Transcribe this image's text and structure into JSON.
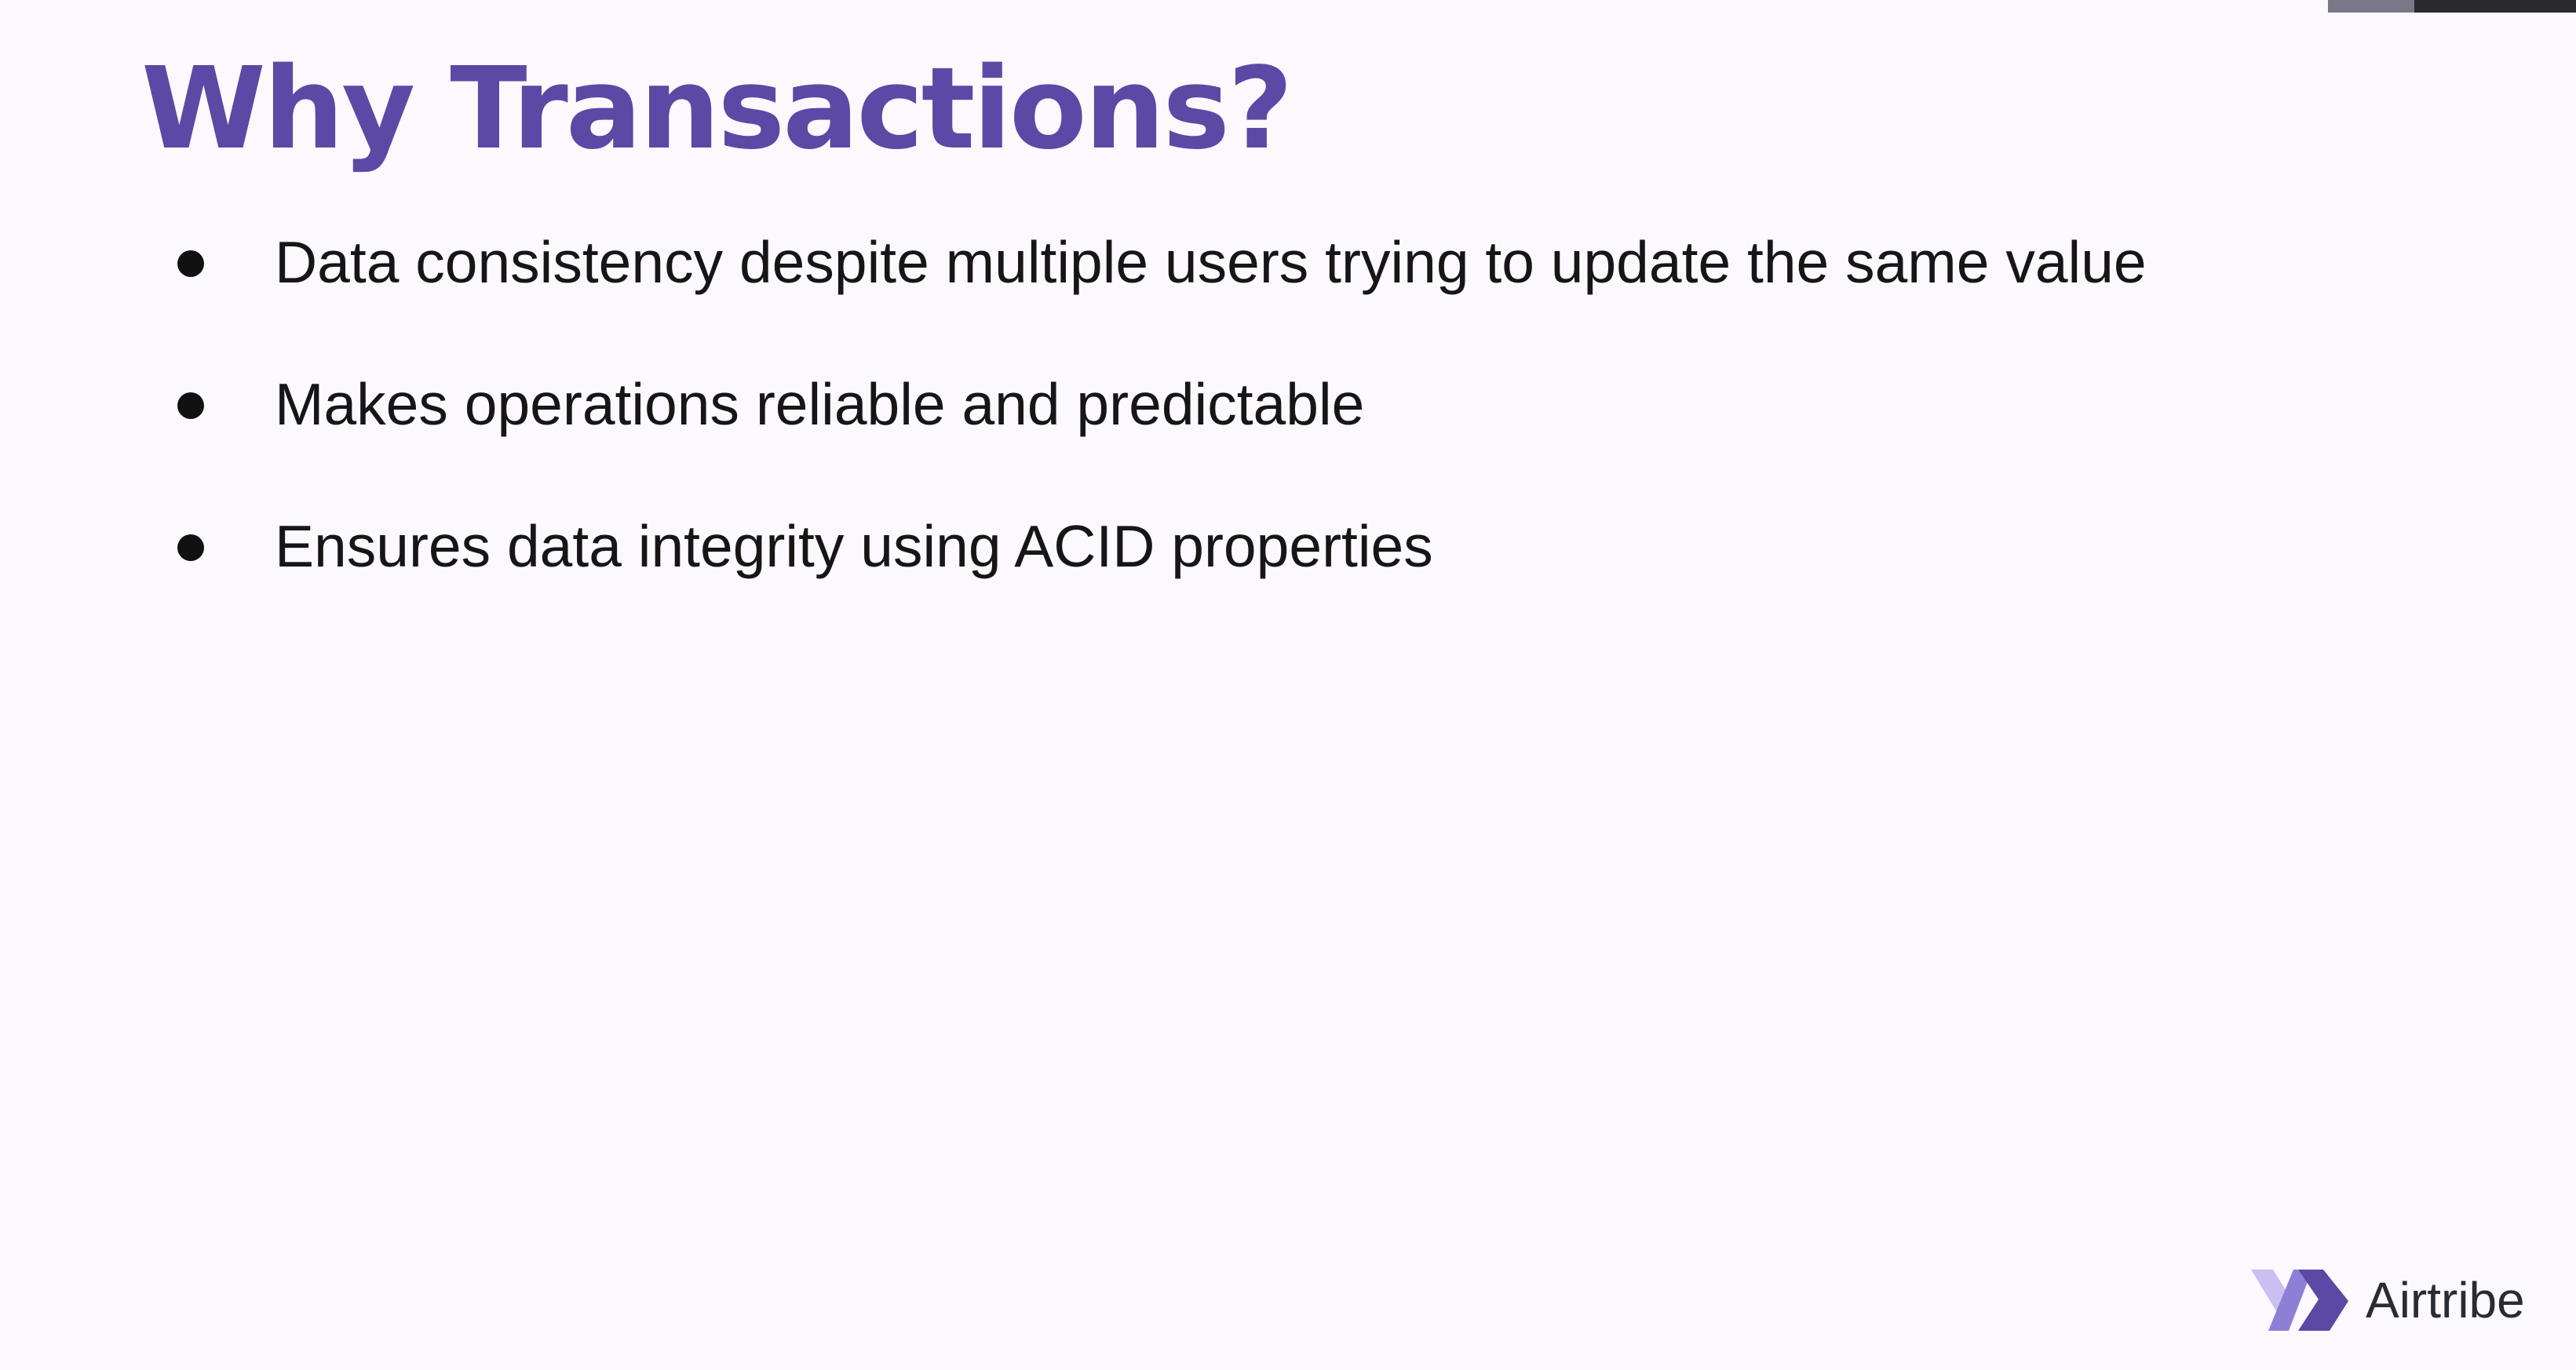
{
  "slide": {
    "title": "Why Transactions?",
    "bullets": [
      {
        "text": "Data consistency despite multiple users trying to update the same value"
      },
      {
        "text": "Makes operations reliable and predictable"
      },
      {
        "text": "Ensures data integrity using ACID properties"
      }
    ]
  },
  "brand": {
    "name": "Airtribe",
    "logo_icon": "airtribe-logo-icon"
  },
  "colors": {
    "title": "#5a4aa5",
    "background": "#fbf9fd",
    "bullet_text": "#161616",
    "logo_light": "#c9bff0",
    "logo_mid": "#8e7fd6",
    "logo_dark": "#5a4aa5"
  }
}
